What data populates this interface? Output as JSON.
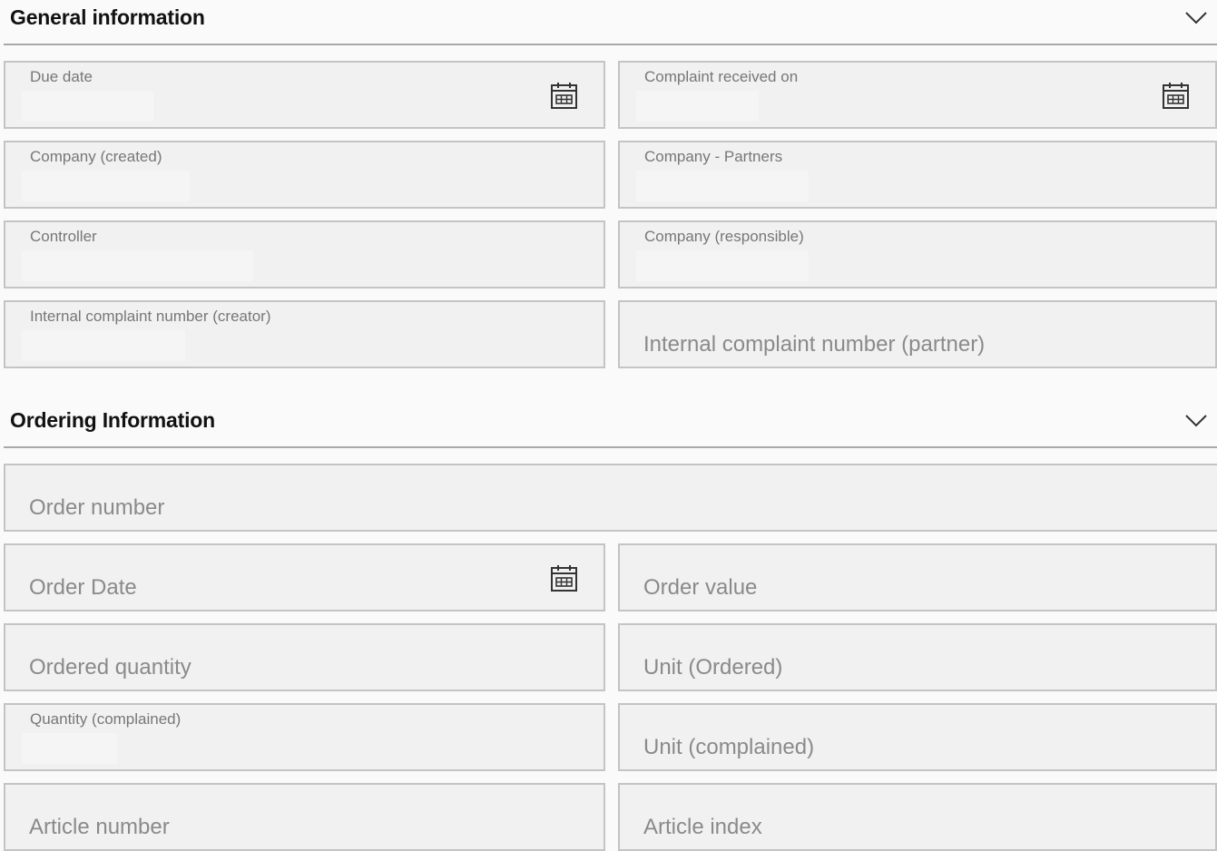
{
  "sections": {
    "general": {
      "title": "General information",
      "chevron_icon": "chevron-down-icon"
    },
    "ordering": {
      "title": "Ordering Information",
      "chevron_icon": "chevron-down-icon"
    }
  },
  "general_fields": {
    "due_date": {
      "label": "Due date",
      "icon": "calendar-icon"
    },
    "complaint_received_on": {
      "label": "Complaint received on",
      "icon": "calendar-icon"
    },
    "company_created": {
      "label": "Company (created)"
    },
    "company_partners": {
      "label": "Company - Partners"
    },
    "controller": {
      "label": "Controller"
    },
    "company_responsible": {
      "label": "Company (responsible)"
    },
    "internal_complaint_creator": {
      "label": "Internal complaint number (creator)"
    },
    "internal_complaint_partner": {
      "label": "Internal complaint number (partner)"
    }
  },
  "ordering_fields": {
    "order_number": {
      "label": "Order number"
    },
    "order_date": {
      "label": "Order Date",
      "icon": "calendar-icon"
    },
    "order_value": {
      "label": "Order value"
    },
    "ordered_quantity": {
      "label": "Ordered quantity"
    },
    "unit_ordered": {
      "label": "Unit (Ordered)"
    },
    "quantity_complained": {
      "label": "Quantity (complained)"
    },
    "unit_complained": {
      "label": "Unit (complained)"
    },
    "article_number": {
      "label": "Article number"
    },
    "article_index": {
      "label": "Article index"
    }
  },
  "colors": {
    "page_background": "#fafafa",
    "field_background": "#f1f1f1",
    "field_border": "#c4c4c4",
    "header_text": "#111111",
    "label_text": "#777777"
  }
}
